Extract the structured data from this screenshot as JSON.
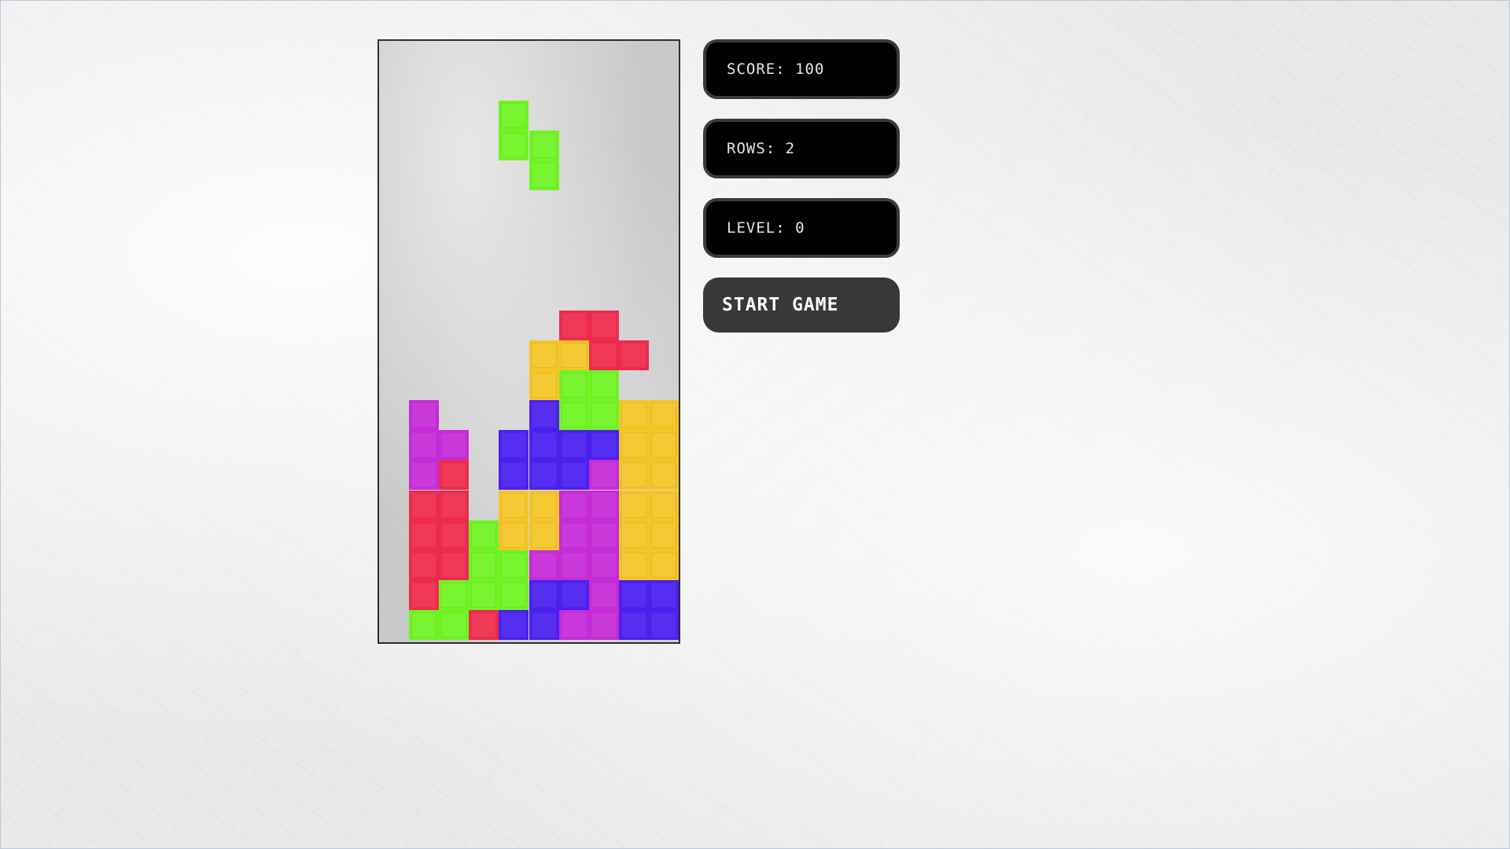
{
  "stats": {
    "score_label": "SCORE:",
    "score_value": "100",
    "rows_label": "ROWS:",
    "rows_value": "2",
    "level_label": "LEVEL:",
    "level_value": "0"
  },
  "controls": {
    "start_label": "START GAME"
  },
  "colors": {
    "green": "#6ef521",
    "red": "#f0294c",
    "yellow": "#f5c525",
    "blue": "#4a1ff0",
    "magenta": "#c92ad9"
  },
  "board": {
    "columns": 10,
    "rows": 20,
    "falling_piece": {
      "shape": "S (vertical)",
      "color": "green",
      "cells": [
        [
          4,
          2
        ],
        [
          4,
          3
        ],
        [
          5,
          3
        ],
        [
          5,
          4
        ]
      ]
    },
    "stack": [
      {
        "row": 9,
        "cells": "......RR.."
      },
      {
        "row": 10,
        "cells": ".....YYRR."
      },
      {
        "row": 11,
        "cells": ".....YGG.."
      },
      {
        "row": 12,
        "cells": ".M...BGGYY"
      },
      {
        "row": 13,
        "cells": ".MM.BBBBYY"
      },
      {
        "row": 14,
        "cells": ".MR.BBBMYY"
      },
      {
        "row": 15,
        "cells": ".RR.YYMMYY"
      },
      {
        "row": 16,
        "cells": ".RRGYYMMYY"
      },
      {
        "row": 17,
        "cells": ".RRGGMMMYY"
      },
      {
        "row": 18,
        "cells": ".RGGGBBMBB"
      },
      {
        "row": 19,
        "cells": ".GGRBBMMBB"
      }
    ]
  }
}
